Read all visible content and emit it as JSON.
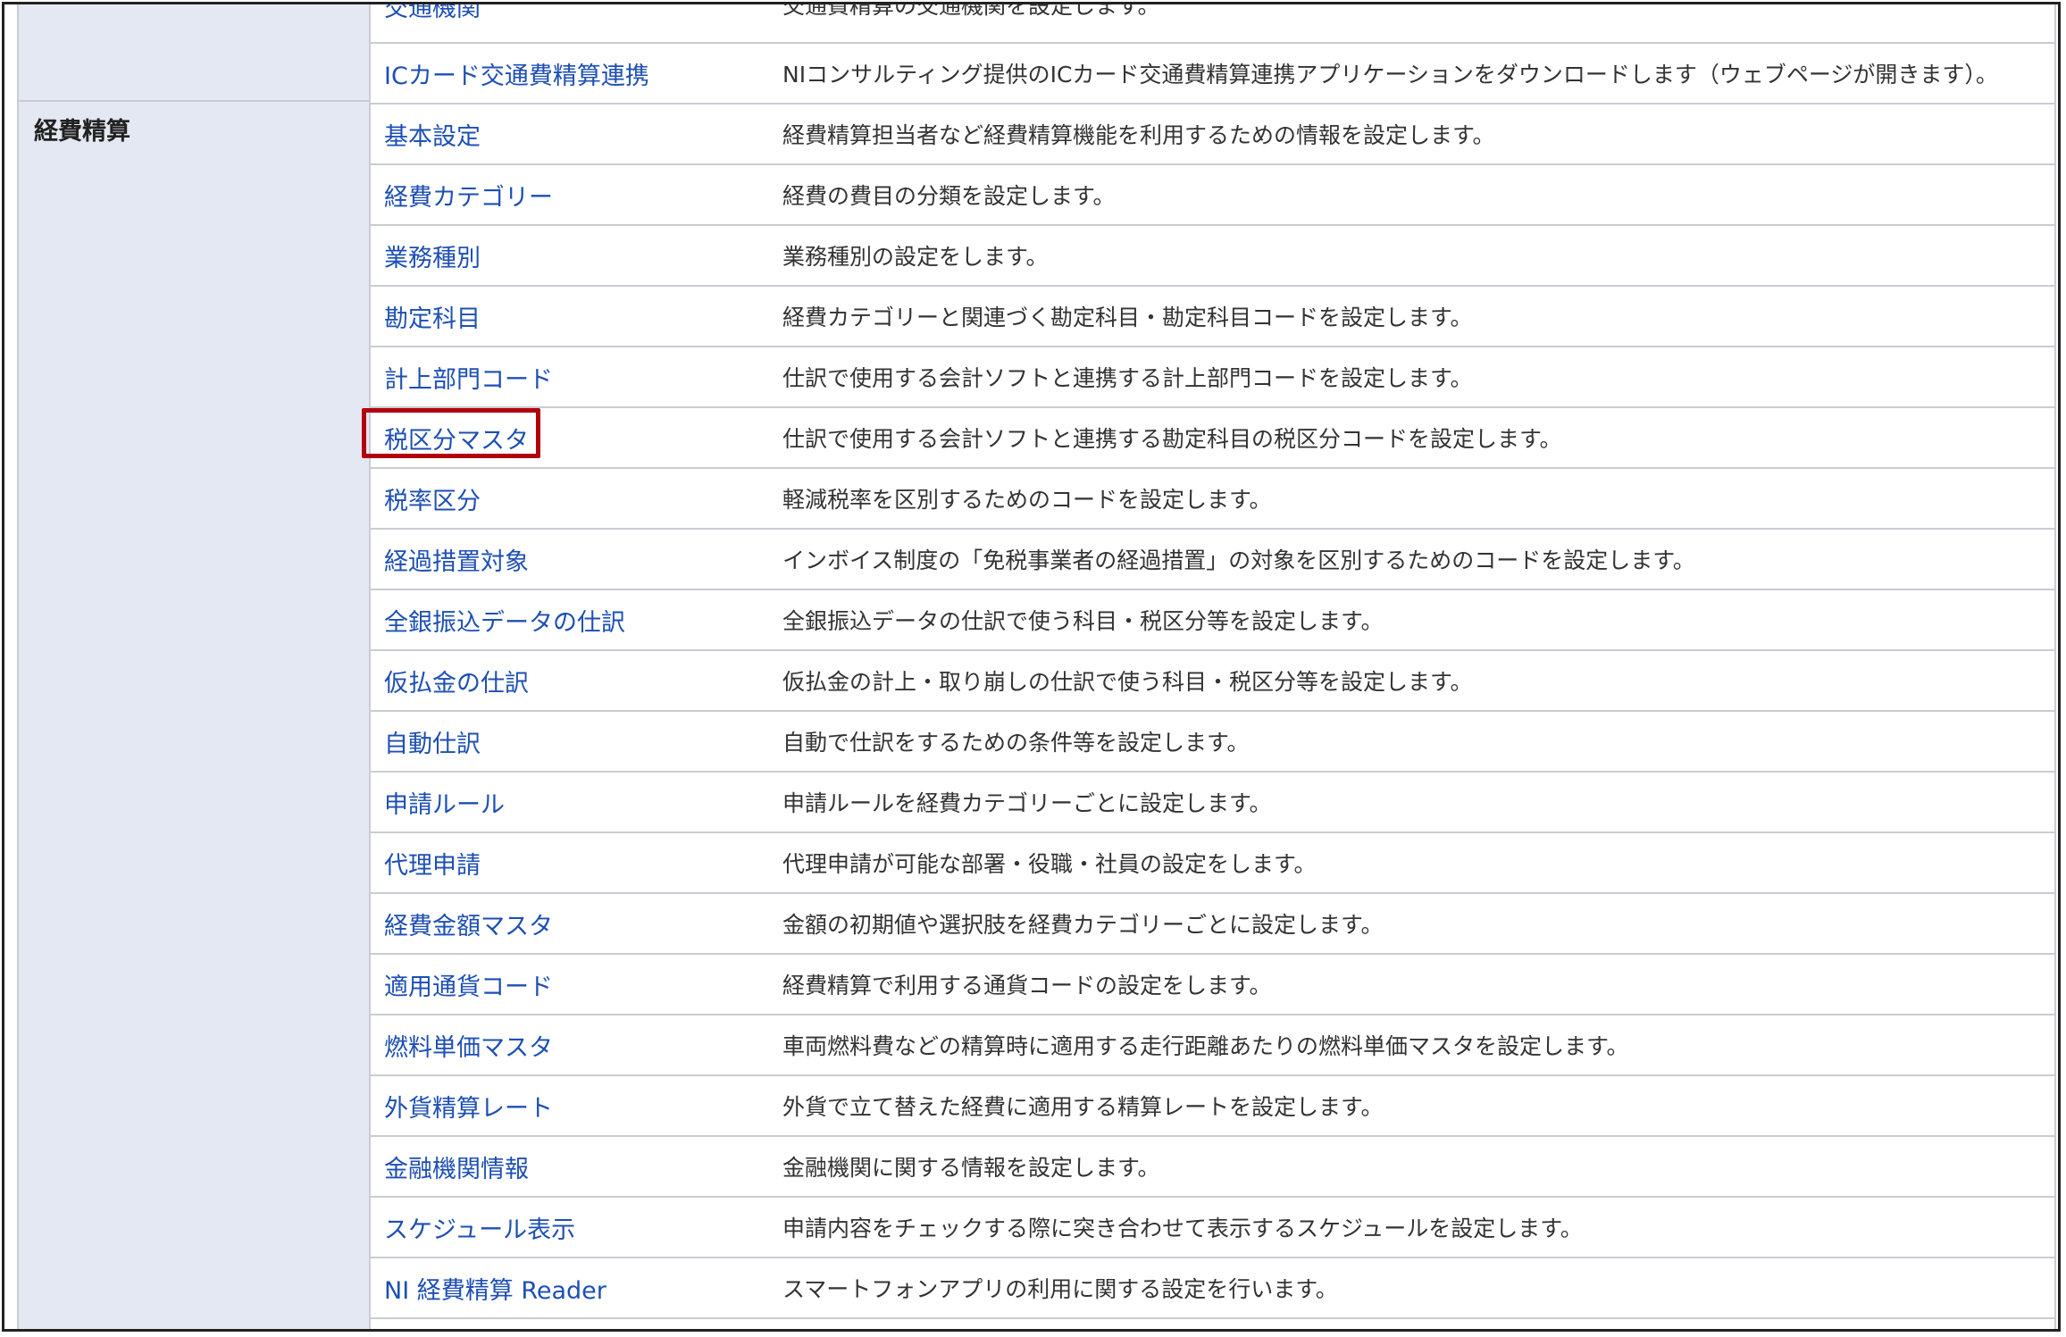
{
  "cutoff_row": {
    "name": "交通機関",
    "desc": "交通費精算の交通機関を設定します。"
  },
  "top_rows": [
    {
      "name": "ICカード交通費精算連携",
      "desc": "NIコンサルティング提供のICカード交通費精算連携アプリケーションをダウンロードします（ウェブページが開きます）。"
    }
  ],
  "category": "経費精算",
  "rows": [
    {
      "name": "基本設定",
      "desc": "経費精算担当者など経費精算機能を利用するための情報を設定します。"
    },
    {
      "name": "経費カテゴリー",
      "desc": "経費の費目の分類を設定します。"
    },
    {
      "name": "業務種別",
      "desc": "業務種別の設定をします。"
    },
    {
      "name": "勘定科目",
      "desc": "経費カテゴリーと関連づく勘定科目・勘定科目コードを設定します。"
    },
    {
      "name": "計上部門コード",
      "desc": "仕訳で使用する会計ソフトと連携する計上部門コードを設定します。"
    },
    {
      "name": "税区分マスタ",
      "desc": "仕訳で使用する会計ソフトと連携する勘定科目の税区分コードを設定します。"
    },
    {
      "name": "税率区分",
      "desc": "軽減税率を区別するためのコードを設定します。"
    },
    {
      "name": "経過措置対象",
      "desc": "インボイス制度の「免税事業者の経過措置」の対象を区別するためのコードを設定します。"
    },
    {
      "name": "全銀振込データの仕訳",
      "desc": "全銀振込データの仕訳で使う科目・税区分等を設定します。"
    },
    {
      "name": "仮払金の仕訳",
      "desc": "仮払金の計上・取り崩しの仕訳で使う科目・税区分等を設定します。"
    },
    {
      "name": "自動仕訳",
      "desc": "自動で仕訳をするための条件等を設定します。"
    },
    {
      "name": "申請ルール",
      "desc": "申請ルールを経費カテゴリーごとに設定します。"
    },
    {
      "name": "代理申請",
      "desc": "代理申請が可能な部署・役職・社員の設定をします。"
    },
    {
      "name": "経費金額マスタ",
      "desc": "金額の初期値や選択肢を経費カテゴリーごとに設定します。"
    },
    {
      "name": "適用通貨コード",
      "desc": "経費精算で利用する通貨コードの設定をします。"
    },
    {
      "name": "燃料単価マスタ",
      "desc": "車両燃料費などの精算時に適用する走行距離あたりの燃料単価マスタを設定します。"
    },
    {
      "name": "外貨精算レート",
      "desc": "外貨で立て替えた経費に適用する精算レートを設定します。"
    },
    {
      "name": "金融機関情報",
      "desc": "金融機関に関する情報を設定します。"
    },
    {
      "name": "スケジュール表示",
      "desc": "申請内容をチェックする際に突き合わせて表示するスケジュールを設定します。"
    },
    {
      "name": "NI 経費精算 Reader",
      "desc": "スマートフォンアプリの利用に関する設定を行います。"
    }
  ],
  "highlighted_item": "税区分マスタ"
}
